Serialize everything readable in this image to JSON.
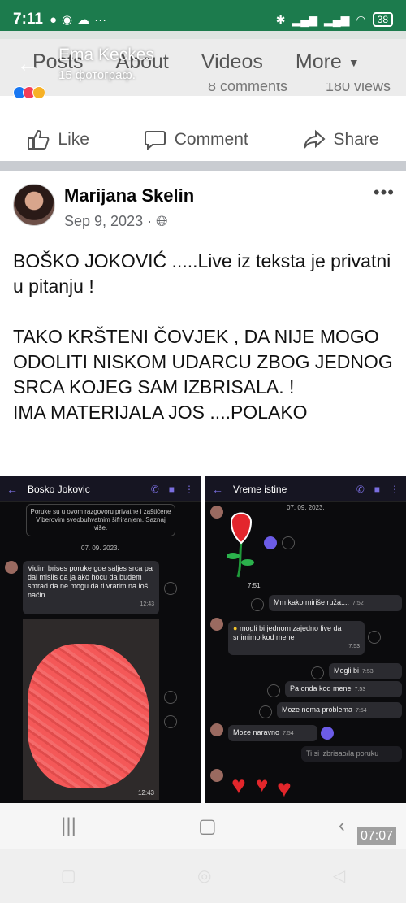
{
  "status": {
    "time": "7:11",
    "battery": "38"
  },
  "header": {
    "overlay_name": "Ema Keckes",
    "overlay_sub": "15 фотограф.",
    "tabs": [
      "Posts",
      "About",
      "Videos",
      "More"
    ]
  },
  "prev_post": {
    "comments": "8 comments",
    "views": "180 views"
  },
  "actions": {
    "like": "Like",
    "comment": "Comment",
    "share": "Share"
  },
  "post": {
    "author": "Marijana Skelin",
    "date": "Sep 9, 2023 ·",
    "text": "BOŠKO JOKOVIĆ .....Live iz teksta je privatni  u pitanju !\n\nTAKO KRŠTENI ČOVJEK , DA NIJE MOGO ODOLITI NISKOM UDARCU ZBOG JEDNOG SRCA KOJEG SAM IZBRISALA. !\nIMA MATERIJALA JOS ....POLAKO"
  },
  "shot1": {
    "name": "Bosko Jokovic",
    "notice": "Poruke su u ovom razgovoru privatne i zaštićene Viberovim sveobuhvatnim šifriranjem. Saznaj više.",
    "date": "07. 09. 2023.",
    "message": "Vidim brises poruke gde saljes srca pa dal mislis da ja ako hocu da budem smrad da ne mogu da ti vratim na loš način",
    "msg_time": "12:43",
    "img_time": "12:43"
  },
  "shot2": {
    "name": "Vreme istine",
    "date": "07. 09. 2023.",
    "sticker_time": "7:51",
    "m1": "Mm kako miriše ruža....",
    "m1_time": "7:52",
    "m2": "mogli bi jednom zajedno live da snimimo kod mene",
    "m2_time": "7:53",
    "m3": "Mogli bi",
    "m3_time": "7:53",
    "m4": "Pa onda kod mene",
    "m4_time": "7:53",
    "m5": "Moze nema problema",
    "m5_time": "7:54",
    "m6": "Moze naravno",
    "m6_time": "7:54",
    "m7": "Ti si izbrisao/la poruku"
  },
  "nav": {
    "time": "07:07"
  }
}
